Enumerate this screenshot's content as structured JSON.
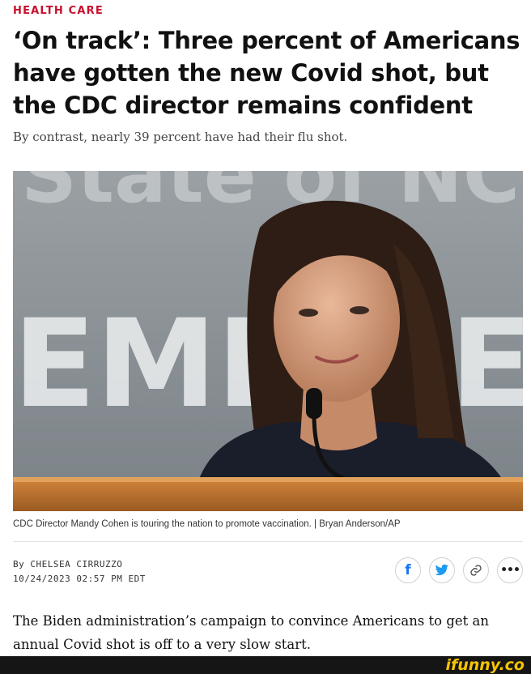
{
  "article": {
    "section": "HEALTH CARE",
    "headline": "‘On track’: Three percent of Americans have gotten the new Covid shot, but the CDC director remains confident",
    "dek": "By contrast, nearly 39 percent have had their flu shot.",
    "caption": "CDC Director Mandy Cohen is touring the nation to promote vaccination. | Bryan Anderson/AP",
    "byline": "By CHELSEA CIRRUZZO",
    "timestamp": "10/24/2023 02:57 PM EDT",
    "body": "The Biden administration’s campaign to convince Americans to get an annual Covid shot is off to a very slow start."
  },
  "photo": {
    "backdrop_top": "State of NC",
    "backdrop_mid": "EME",
    "backdrop_right": "E"
  },
  "share": {
    "icons": [
      "facebook-icon",
      "twitter-icon",
      "link-icon",
      "more-icon"
    ],
    "colors": {
      "facebook": "#1877f2",
      "twitter": "#1d9bf0"
    }
  },
  "footer": {
    "watermark": "ifunny.co"
  },
  "colors": {
    "section": "#c8102e"
  }
}
